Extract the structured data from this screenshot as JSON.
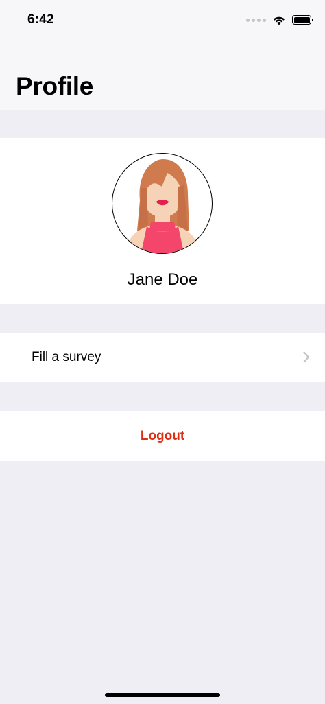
{
  "status_bar": {
    "time": "6:42",
    "icons": [
      "signal-dots-icon",
      "wifi-icon",
      "battery-icon"
    ]
  },
  "header": {
    "title": "Profile"
  },
  "profile": {
    "name": "Jane Doe",
    "avatar_icon": "female-avatar-icon"
  },
  "menu": {
    "survey_label": "Fill a survey",
    "survey_icon": "chevron-right-icon",
    "logout_label": "Logout"
  },
  "colors": {
    "background": "#efeef4",
    "logout": "#e02d12",
    "avatar_shirt": "#f3466a",
    "avatar_hair": "#cf7b4e"
  }
}
